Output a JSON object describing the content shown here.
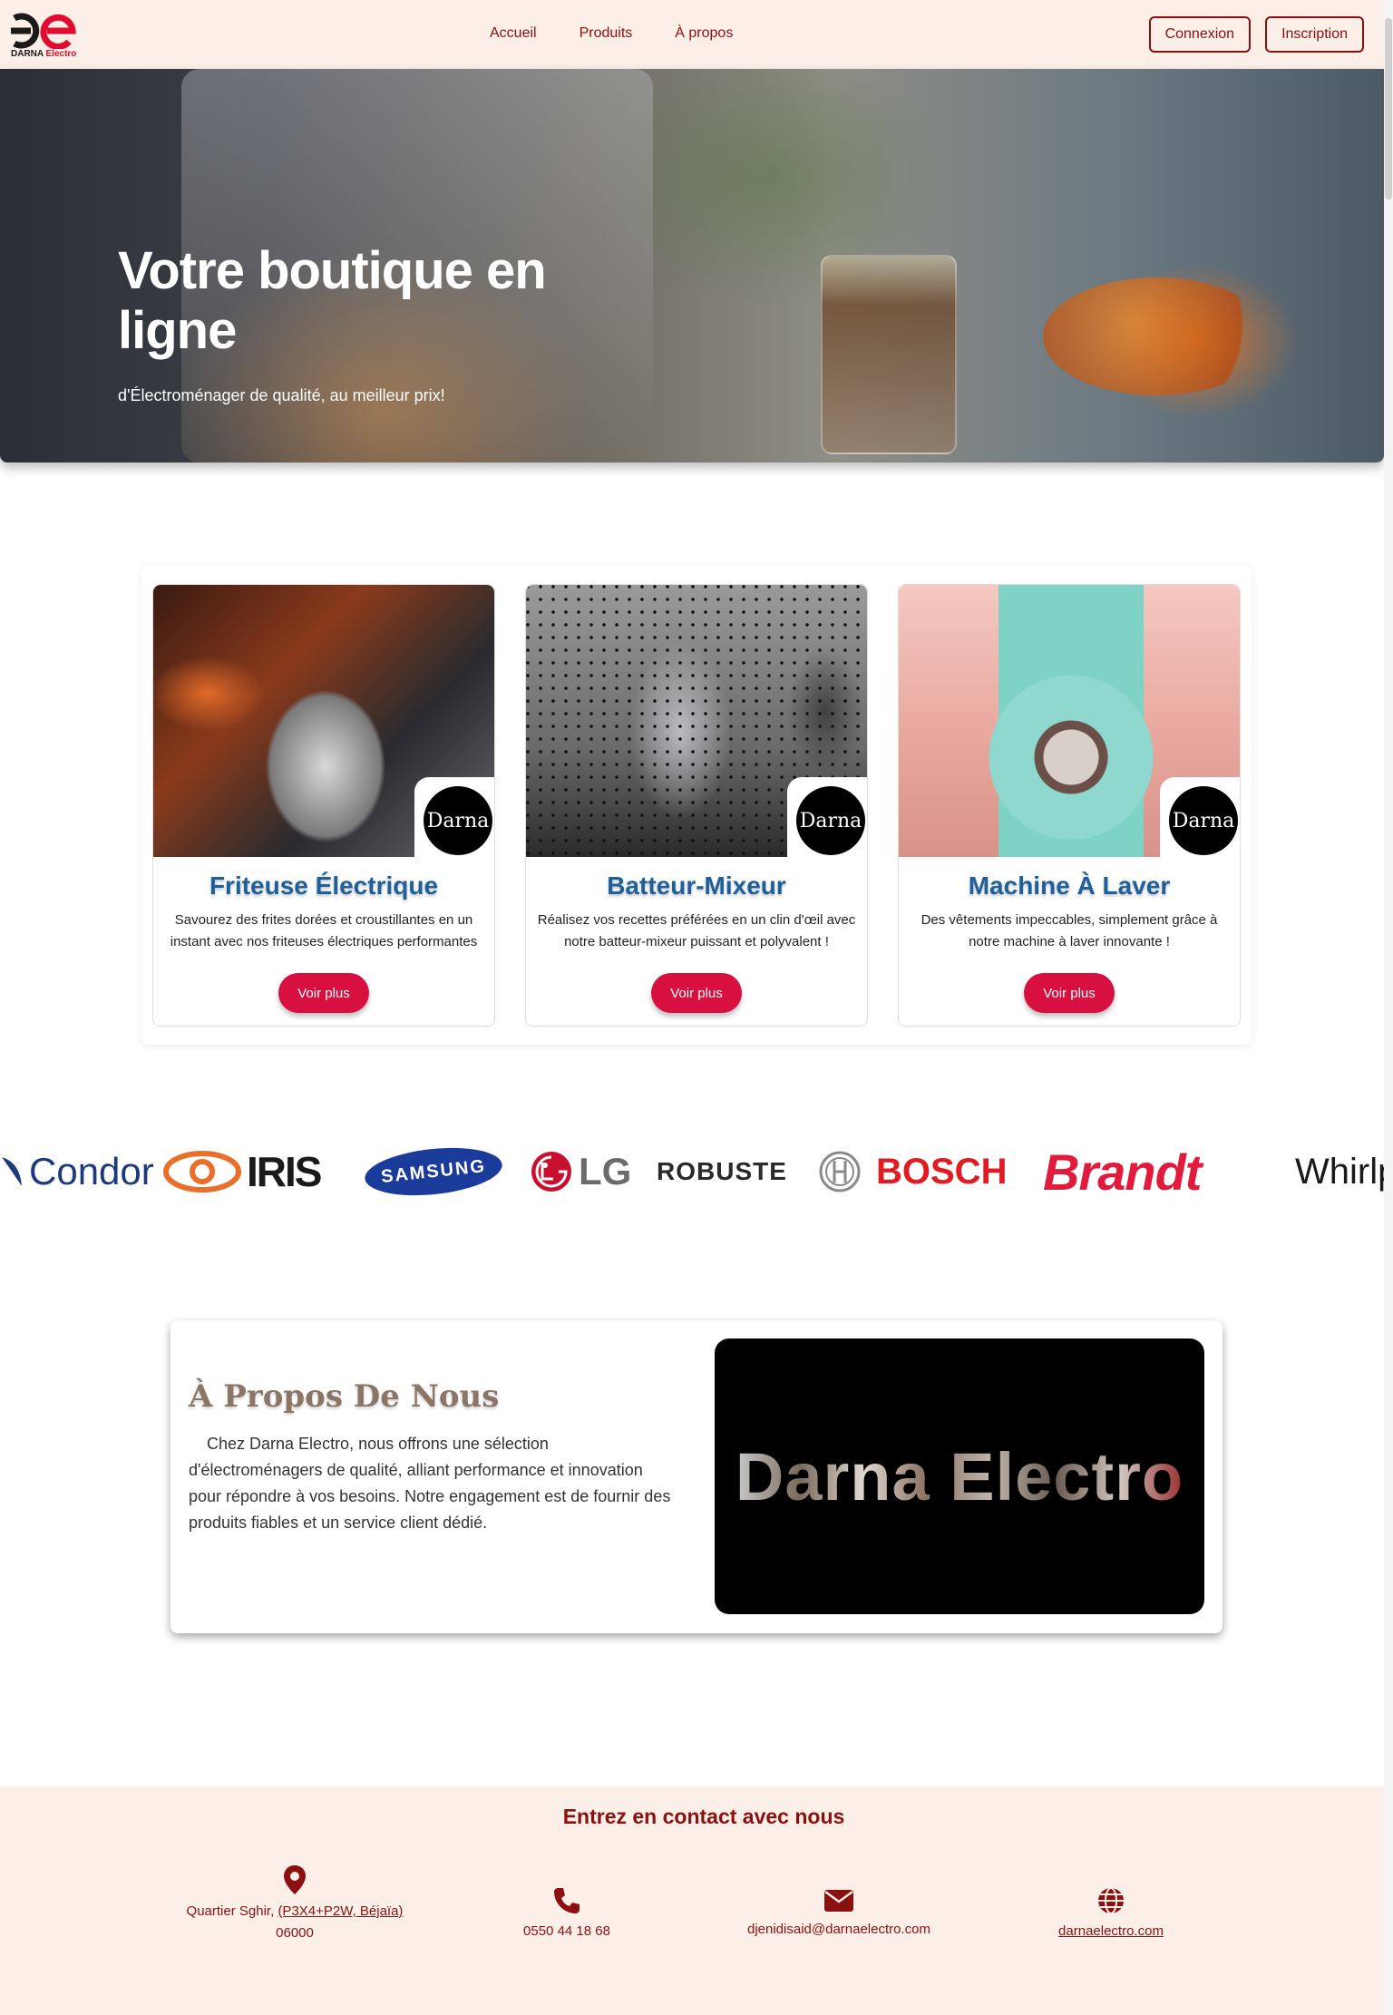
{
  "header": {
    "logo_letters": "De",
    "logo_brand": "DARNA ",
    "logo_brand_accent": "Electro",
    "nav": [
      {
        "label": "Accueil"
      },
      {
        "label": "Produits"
      },
      {
        "label": "À propos"
      }
    ],
    "login_label": "Connexion",
    "signup_label": "Inscription"
  },
  "hero": {
    "title": "Votre boutique en ligne",
    "subtitle": "d'Électroménager de qualité, au meilleur prix!"
  },
  "products": [
    {
      "title": "Friteuse Électrique",
      "description": "Savourez des frites dorées et croustillantes en un instant avec nos friteuses électriques performantes",
      "button": "Voir plus",
      "badge": "Darna"
    },
    {
      "title": "Batteur-Mixeur",
      "description": "Réalisez vos recettes préférées en un clin d'œil avec notre batteur-mixeur puissant et polyvalent !",
      "button": "Voir plus",
      "badge": "Darna"
    },
    {
      "title": "Machine À Laver",
      "description": "Des vêtements impeccables, simplement grâce à notre machine à laver innovante !",
      "button": "Voir plus",
      "badge": "Darna"
    }
  ],
  "brands": [
    {
      "name": "Condor"
    },
    {
      "name": "IRIS"
    },
    {
      "name": "SAMSUNG"
    },
    {
      "name": "LG"
    },
    {
      "name": "ROBUSTE"
    },
    {
      "name": "BOSCH"
    },
    {
      "name": "Brandt"
    },
    {
      "name": "Whirlpool",
      "visible": "Whirlp"
    }
  ],
  "about": {
    "title": "À Propos De Nous",
    "text": "Chez Darna Electro, nous offrons une sélection d'électroménagers de qualité, alliant performance et innovation pour répondre à vos besoins. Notre engagement est de fournir des produits fiables et un service client dédié.",
    "media_text": "Darna Electro"
  },
  "footer": {
    "title": "Entrez en contact avec nous",
    "address_line1": "Quartier Sghir, ",
    "address_link": "(P3X4+P2W, Béjaïa)",
    "address_line2": "06000",
    "phone": "0550 44 18 68",
    "email": "djenidisaid@darnaelectro.com",
    "website": "darnaelectro.com"
  },
  "colors": {
    "brand_red": "#8b1010",
    "accent_red": "#d8103f",
    "title_blue": "#1f5f9a",
    "header_bg": "#fbefe8"
  },
  "icons": [
    "location-icon",
    "phone-icon",
    "mail-icon",
    "globe-icon"
  ]
}
